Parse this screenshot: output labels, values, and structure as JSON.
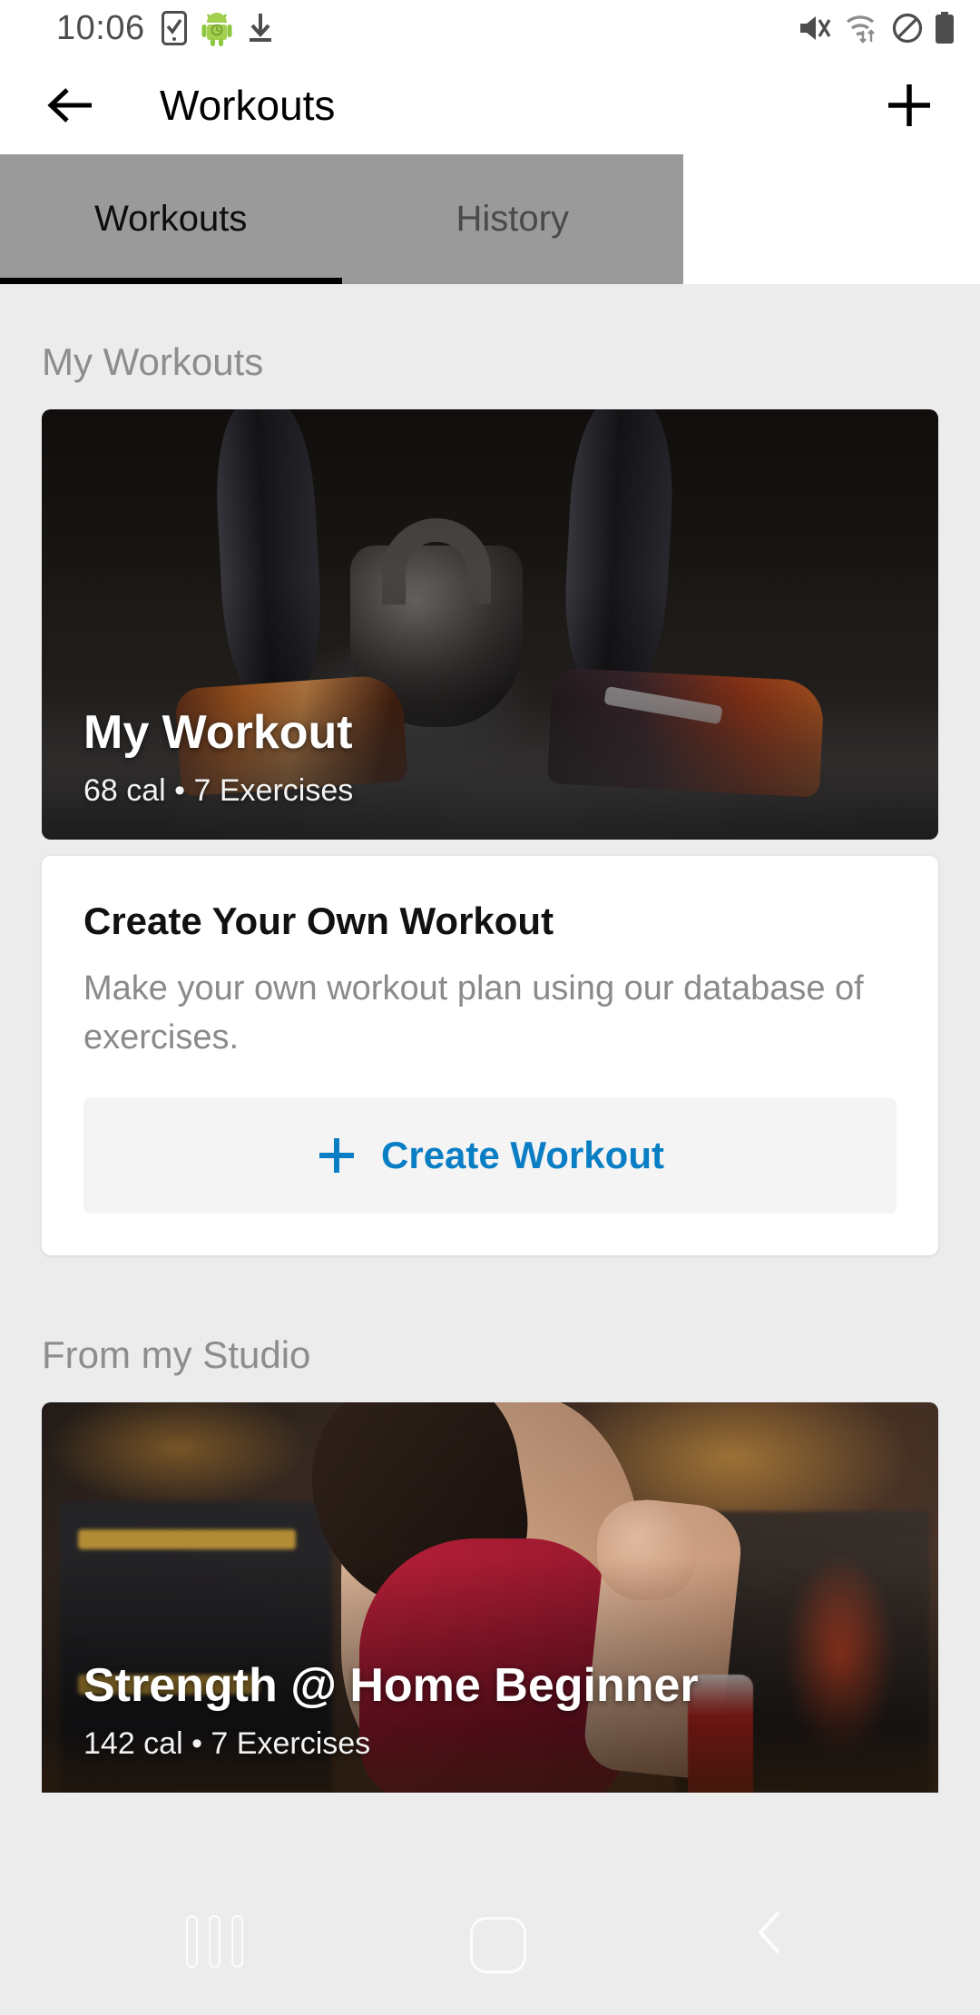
{
  "status_bar": {
    "time": "10:06",
    "left_icons": [
      "phone-check-icon",
      "android-robot-icon",
      "download-icon"
    ],
    "right_icons": [
      "mute-icon",
      "wifi-icon",
      "do-not-disturb-icon",
      "battery-icon"
    ]
  },
  "app_bar": {
    "back_icon": "back-arrow-icon",
    "title": "Workouts",
    "add_icon": "plus-icon"
  },
  "tabs": [
    {
      "label": "Workouts",
      "active": true
    },
    {
      "label": "History",
      "active": false
    }
  ],
  "sections": [
    {
      "heading": "My Workouts",
      "workout_card": {
        "title": "My Workout",
        "subtitle": "68 cal • 7 Exercises",
        "calories": "68 cal",
        "exercises": "7 Exercises"
      },
      "create_card": {
        "title": "Create Your Own Workout",
        "description": "Make your own workout plan using our database of exercises.",
        "button_label": "Create Workout",
        "button_icon": "plus-icon"
      }
    },
    {
      "heading": "From my Studio",
      "workout_card": {
        "title": "Strength @ Home Beginner",
        "subtitle": "142 cal • 7 Exercises",
        "calories": "142 cal",
        "exercises": "7 Exercises"
      }
    }
  ],
  "nav_bar": {
    "recents_icon": "recents-icon",
    "home_icon": "home-icon",
    "back_icon": "back-chevron-icon"
  },
  "colors": {
    "accent_blue": "#0a7ec4",
    "tab_bar_gray": "#9a9a9a",
    "content_bg": "#ececec",
    "section_heading": "#8d8d8d"
  }
}
